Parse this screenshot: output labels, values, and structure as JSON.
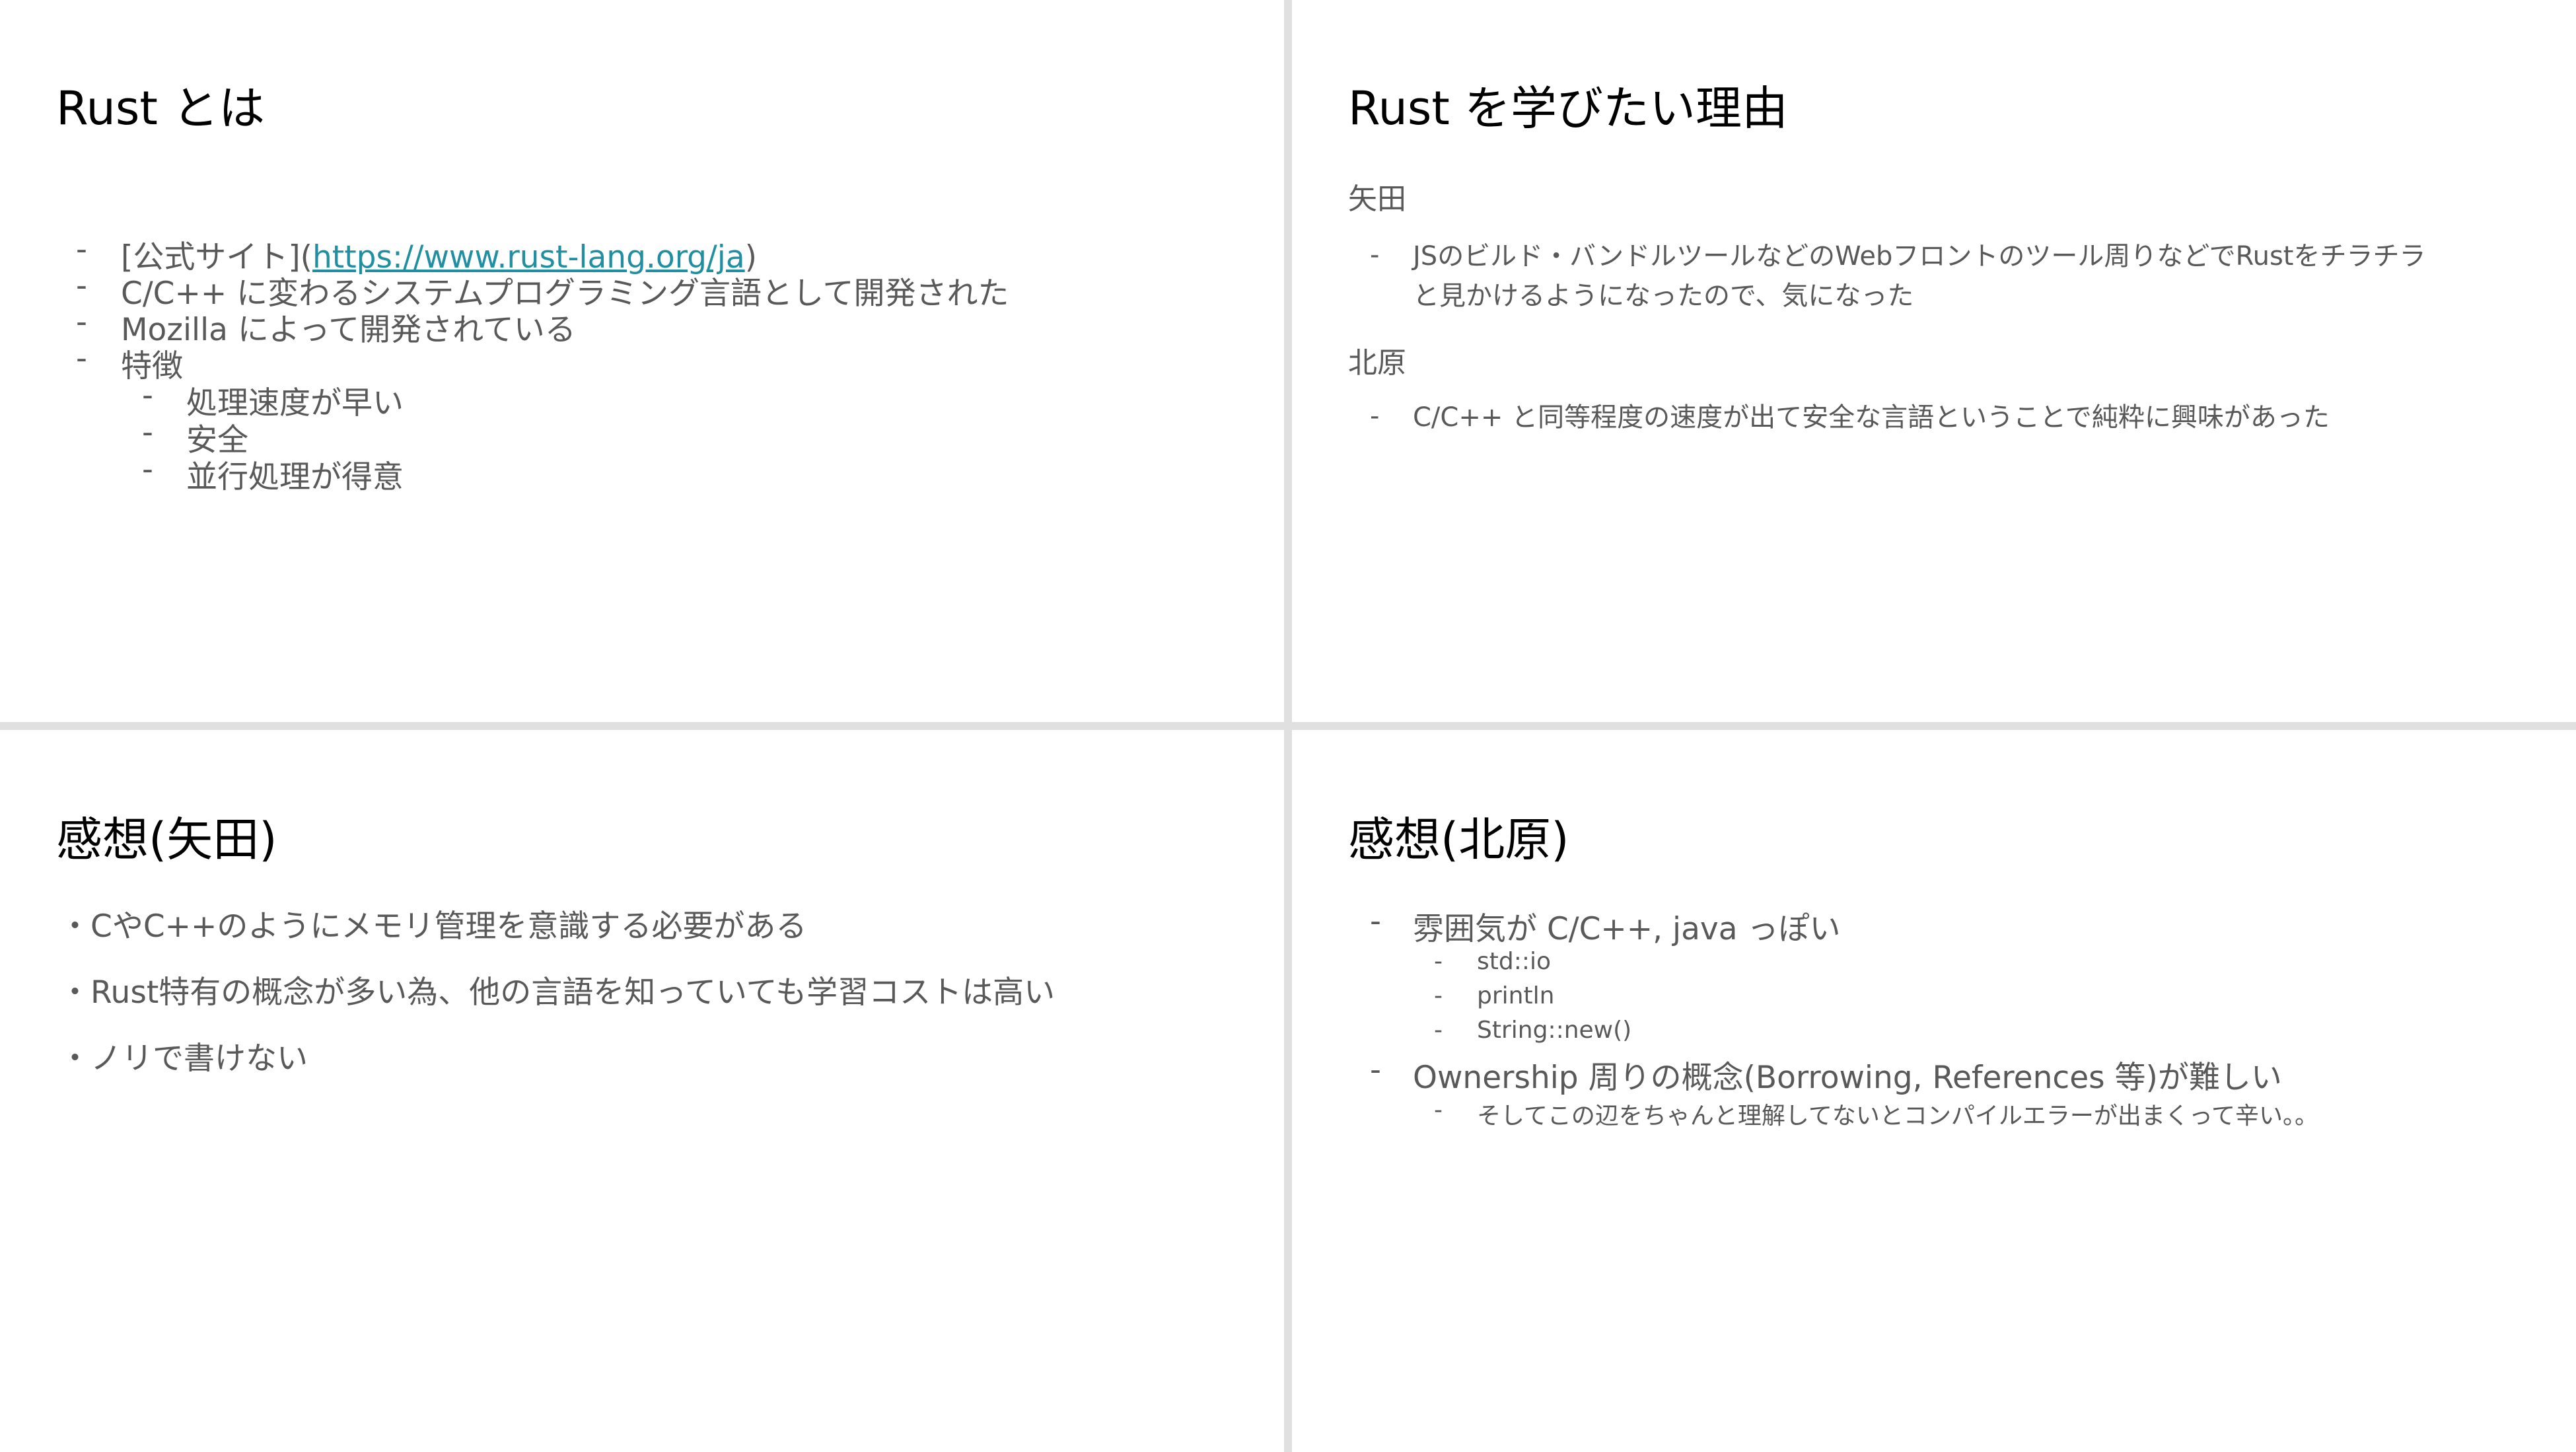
{
  "slides": {
    "s1": {
      "title": "Rust とは",
      "items": [
        {
          "dash": "-",
          "prefix": "[公式サイト](",
          "link": "https://www.rust-lang.org/ja",
          "suffix": ")"
        },
        {
          "dash": "-",
          "text": "C/C++ に変わるシステムプログラミング言語として開発された"
        },
        {
          "dash": "-",
          "text": "Mozilla によって開発されている"
        },
        {
          "dash": "-",
          "text": "特徴"
        }
      ],
      "subitems": [
        {
          "dash": "-",
          "text": "処理速度が早い"
        },
        {
          "dash": "-",
          "text": "安全"
        },
        {
          "dash": "-",
          "text": "並行処理が得意"
        }
      ]
    },
    "s2": {
      "title": "Rust を学びたい理由",
      "person1": "矢田",
      "p1_items": [
        {
          "dash": "-",
          "line1": "JSのビルド・バンドルツールなどのWebフロントのツール周りなどでRustをチラチラ",
          "line2": "と見かけるようになったので、気になった"
        }
      ],
      "person2": "北原",
      "p2_items": [
        {
          "dash": "-",
          "text": "C/C++ と同等程度の速度が出て安全な言語ということで純粋に興味があった"
        }
      ]
    },
    "s3": {
      "title": "感想(矢田)",
      "lines": [
        "・CやC++のようにメモリ管理を意識する必要がある",
        "・Rust特有の概念が多い為、他の言語を知っていても学習コストは高い",
        "・ノリで書けない"
      ]
    },
    "s4": {
      "title": "感想(北原)",
      "item1": {
        "dash": "-",
        "text": "雰囲気が C/C++, java っぽい"
      },
      "item1_subs": [
        {
          "dash": "-",
          "text": "std::io"
        },
        {
          "dash": "-",
          "text": "println"
        },
        {
          "dash": "-",
          "text": "String::new()"
        }
      ],
      "item2": {
        "dash": "-",
        "text": "Ownership 周りの概念(Borrowing, References 等)が難しい"
      },
      "item2_subs": [
        {
          "dash": "-",
          "text": "そしてこの辺をちゃんと理解してないとコンパイルエラーが出まくって辛い。。"
        }
      ]
    }
  }
}
